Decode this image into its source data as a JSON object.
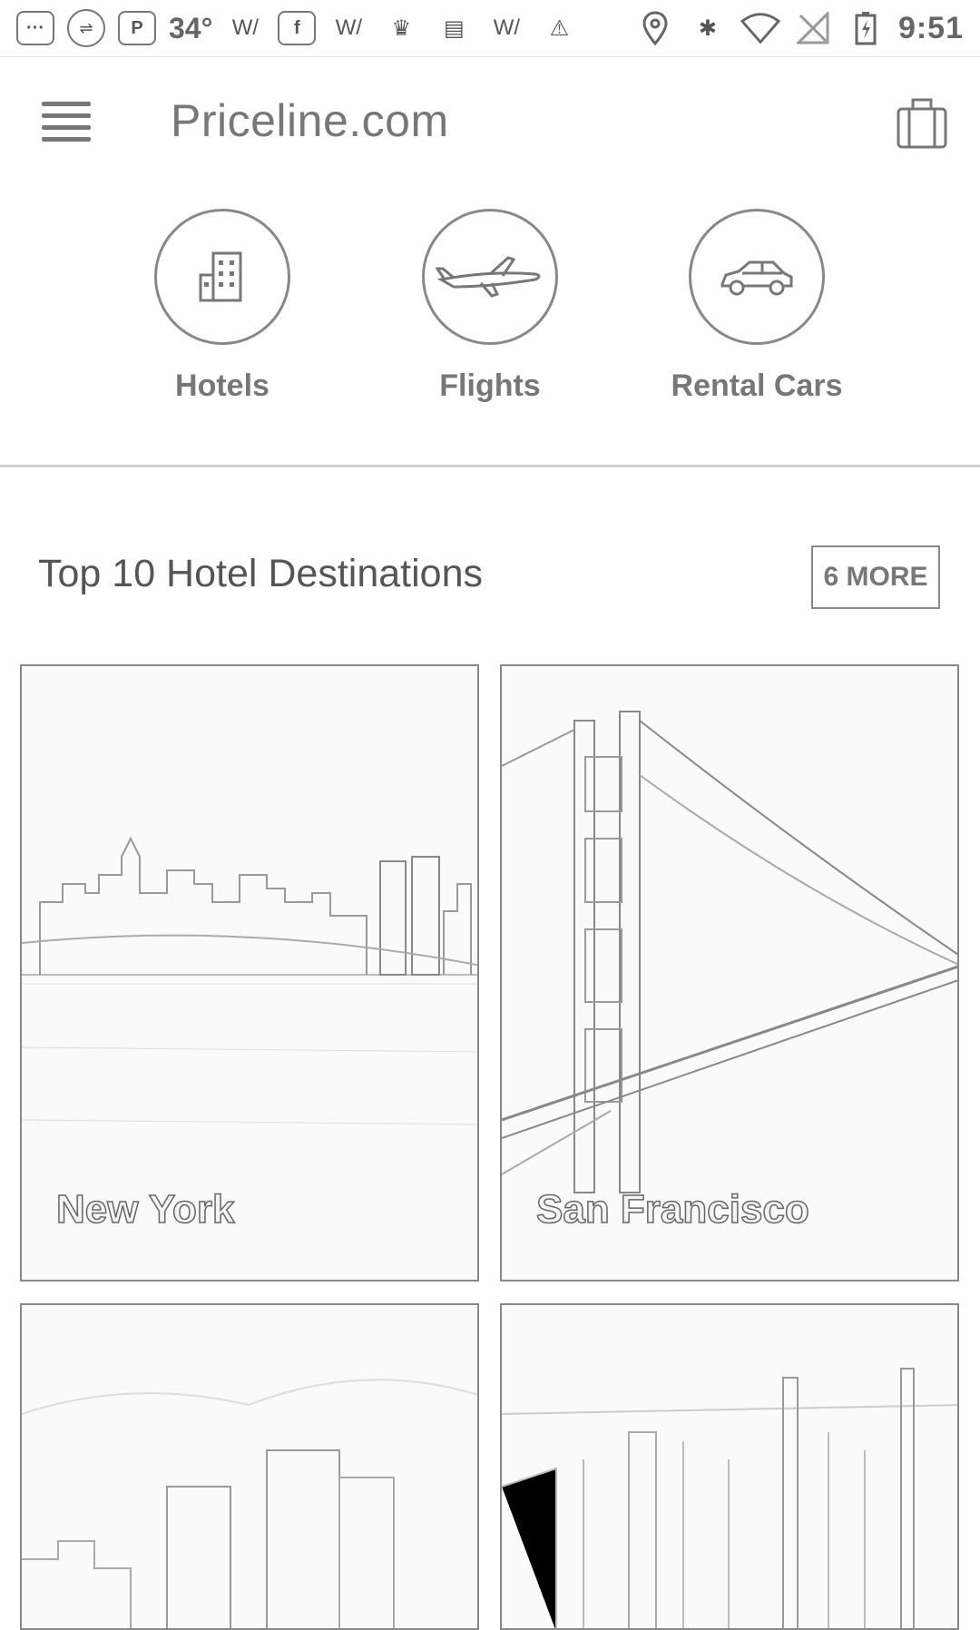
{
  "status_bar": {
    "temperature": "34°",
    "time": "9:51",
    "parking_label": "P"
  },
  "app_bar": {
    "title": "Priceline.com"
  },
  "verticals": [
    {
      "label": "Hotels",
      "icon": "hotel-building-icon"
    },
    {
      "label": "Flights",
      "icon": "airplane-icon"
    },
    {
      "label": "Rental Cars",
      "icon": "car-icon"
    }
  ],
  "destinations_section": {
    "title": "Top 10 Hotel Destinations",
    "more_label": "6 MORE",
    "cities": [
      {
        "name": "New York"
      },
      {
        "name": "San Francisco"
      },
      {
        "name": ""
      },
      {
        "name": ""
      }
    ]
  }
}
